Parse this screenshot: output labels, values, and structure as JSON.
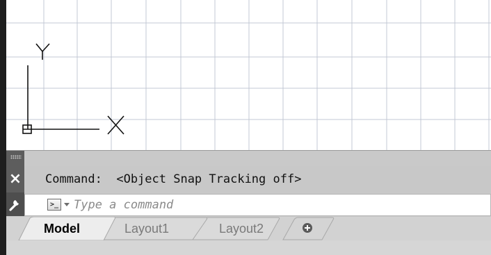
{
  "colors": {
    "grid_line": "#c3c8d4",
    "canvas_bg": "#ffffff",
    "panel_bg": "#c9c9c9",
    "panel_dark": "#5d5d5d"
  },
  "ucs": {
    "y_label": "Y",
    "x_label": "X"
  },
  "command_line": {
    "history_text": "Command:  <Object Snap Tracking off>",
    "close_icon": "×",
    "prompt_icon_glyph": ">_",
    "input_placeholder": "Type a command",
    "input_value": ""
  },
  "tabs": [
    {
      "label": "Model",
      "active": true
    },
    {
      "label": "Layout1",
      "active": false
    },
    {
      "label": "Layout2",
      "active": false
    }
  ],
  "icons": {
    "grip": "grip-dots-icon",
    "close": "close-icon",
    "customize": "wrench-icon",
    "prompt": "command-prompt-icon",
    "add_layout": "plus-icon"
  }
}
